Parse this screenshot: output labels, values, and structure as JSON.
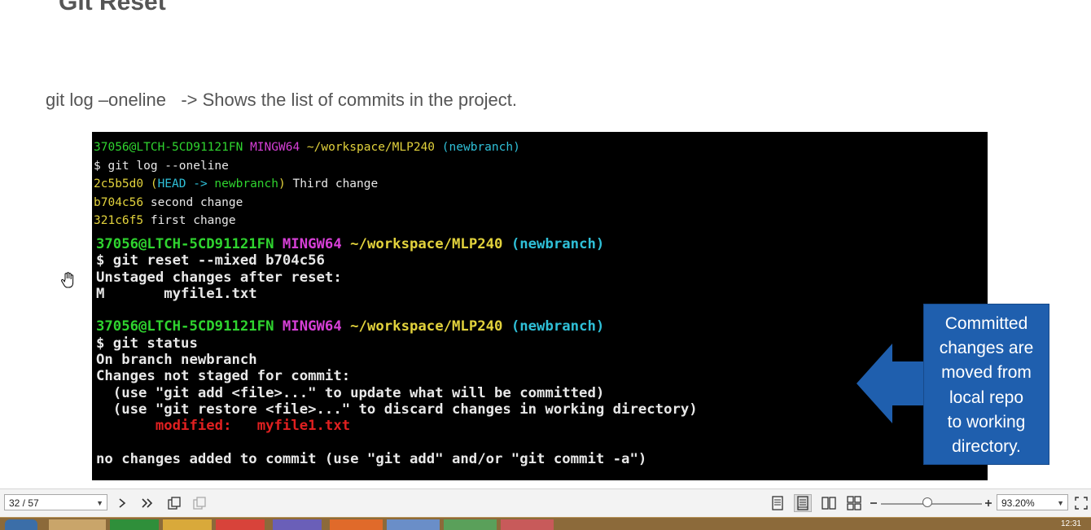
{
  "slide": {
    "title": "Git Reset",
    "subtitle": "git log –oneline   -> Shows the list of commits in the project."
  },
  "terminal_small": {
    "prompt_user": "37056@LTCH-5CD91121FN",
    "prompt_shell": "MINGW64",
    "prompt_path": "~/workspace/MLP240",
    "prompt_branch": "(newbranch)",
    "command": "$ git log --oneline",
    "commits": [
      {
        "hash": "2c5b5d0",
        "ref_open": "(",
        "ref_head": "HEAD ->",
        "ref_branch": "newbranch",
        "ref_close": ")",
        "msg": "Third change"
      },
      {
        "hash": "b704c56",
        "msg": "second change"
      },
      {
        "hash": "321c6f5",
        "msg": "first change"
      }
    ]
  },
  "terminal_large": {
    "prompt_user": "37056@LTCH-5CD91121FN",
    "prompt_shell": "MINGW64",
    "prompt_path": "~/workspace/MLP240",
    "prompt_branch": "(newbranch)",
    "cmd1": "$ git reset --mixed b704c56",
    "line_unstaged": "Unstaged changes after reset:",
    "line_m_flag": "M",
    "line_m_file": "myfile1.txt",
    "cmd2": "$ git status",
    "line_on_branch": "On branch newbranch",
    "line_not_staged": "Changes not staged for commit:",
    "line_use_add": "  (use \"git add <file>...\" to update what will be committed)",
    "line_use_restore": "  (use \"git restore <file>...\" to discard changes in working directory)",
    "modified_label": "modified:",
    "modified_file": "myfile1.txt",
    "line_no_changes": "no changes added to commit (use \"git add\" and/or \"git commit -a\")"
  },
  "callout": {
    "lines": [
      "Committed",
      "changes are",
      "moved from",
      "local repo",
      "to working",
      "directory."
    ],
    "bg_color": "#1f5fae",
    "arrow_color": "#1f5fae"
  },
  "viewer": {
    "page_indicator": "32 / 57",
    "zoom": "93.20%",
    "icons": [
      "next-page-icon",
      "last-page-icon",
      "rotate-icon",
      "fit-icon",
      "single-page-icon",
      "continuous-page-icon",
      "two-page-icon",
      "two-page-continuous-icon",
      "zoom-out-icon",
      "zoom-in-icon",
      "fullscreen-icon"
    ]
  },
  "taskbar": {
    "clock": "12:31"
  },
  "colors": {
    "term_green": "#2fd42f",
    "term_magenta": "#d63fd6",
    "term_yellow": "#e2d23c",
    "term_cyan": "#2fc0d8",
    "term_red": "#e02020"
  }
}
